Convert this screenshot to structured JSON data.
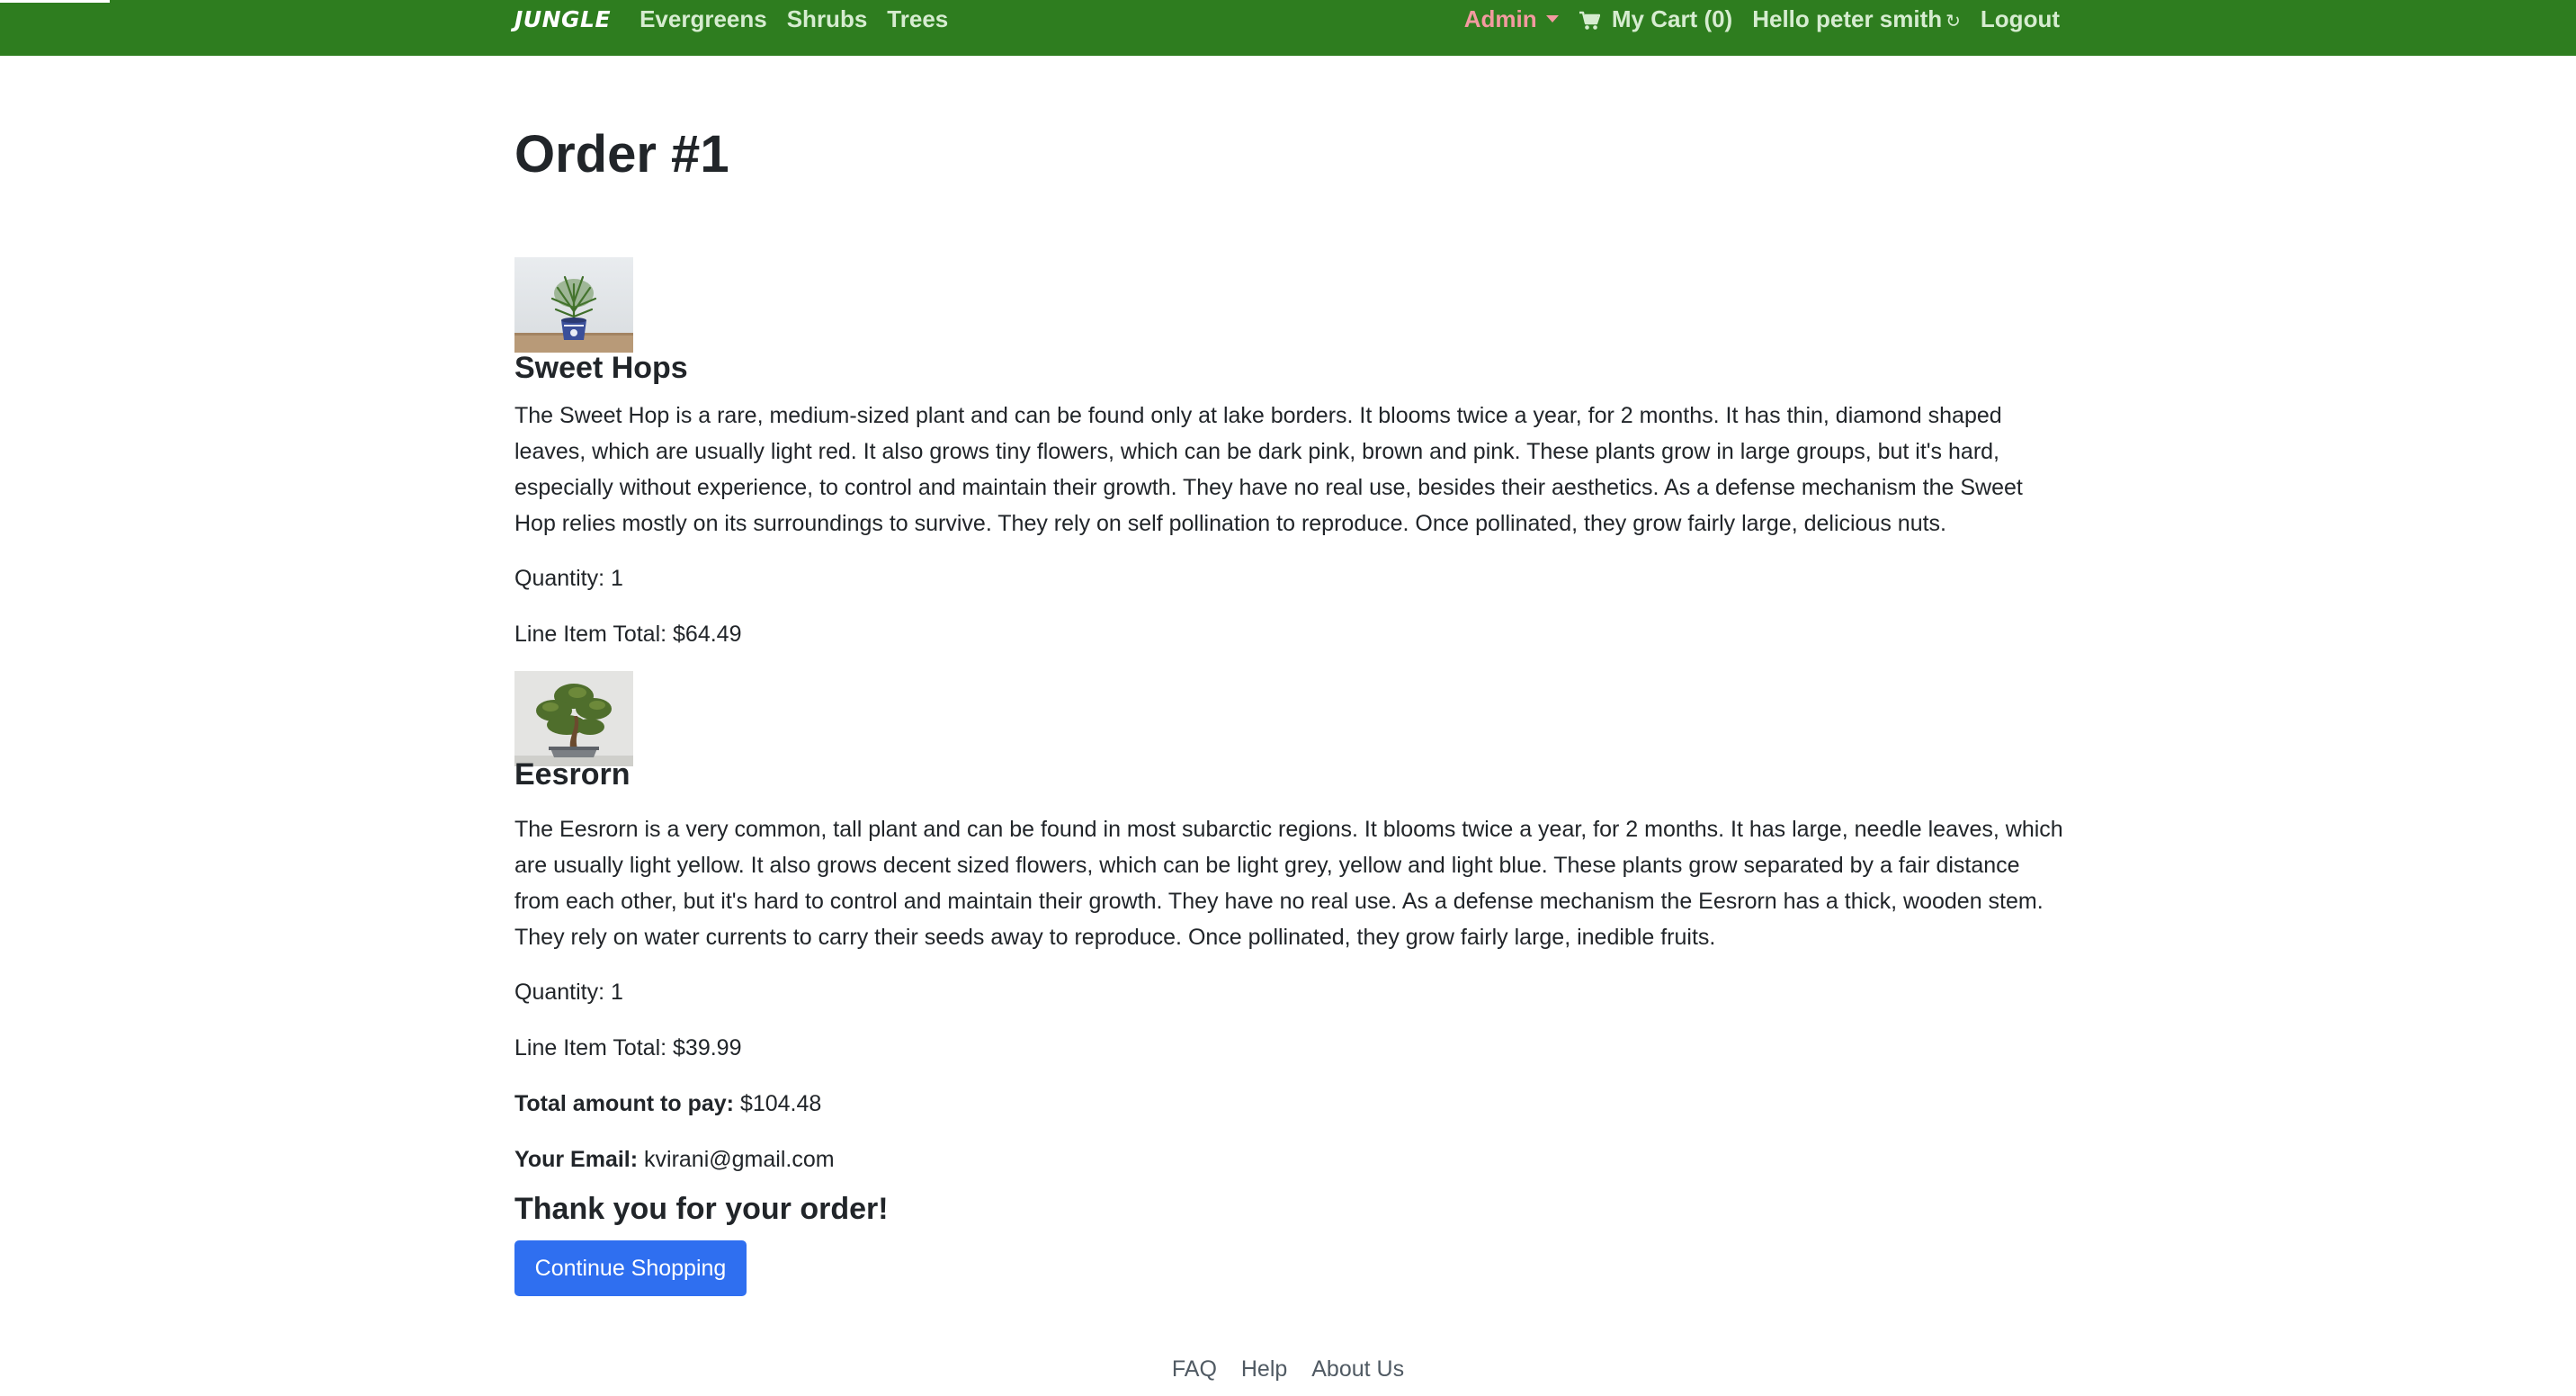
{
  "nav": {
    "brand": "JUNGLE",
    "links": [
      "Evergreens",
      "Shrubs",
      "Trees"
    ],
    "admin": "Admin",
    "cart": "My Cart (0)",
    "greeting": "Hello peter smith",
    "logout": "Logout",
    "colors": {
      "bar": "#2e7d1f",
      "admin": "#f39aa0"
    }
  },
  "order": {
    "title": "Order #1",
    "items": [
      {
        "name": "Sweet Hops",
        "description": "The Sweet Hop is a rare, medium-sized plant and can be found only at lake borders. It blooms twice a year, for 2 months. It has thin, diamond shaped leaves, which are usually light red. It also grows tiny flowers, which can be dark pink, brown and pink. These plants grow in large groups, but it's hard, especially without experience, to control and maintain their growth. They have no real use, besides their aesthetics. As a defense mechanism the Sweet Hop relies mostly on its surroundings to survive. They rely on self pollination to reproduce. Once pollinated, they grow fairly large, delicious nuts.",
        "quantity": "Quantity: 1",
        "line_total": "Line Item Total: $64.49",
        "image_icon": "potted-plant-icon"
      },
      {
        "name": "Eesrorn",
        "description": "The Eesrorn is a very common, tall plant and can be found in most subarctic regions. It blooms twice a year, for 2 months. It has large, needle leaves, which are usually light yellow. It also grows decent sized flowers, which can be light grey, yellow and light blue. These plants grow separated by a fair distance from each other, but it's hard to control and maintain their growth. They have no real use. As a defense mechanism the Eesrorn has a thick, wooden stem. They rely on water currents to carry their seeds away to reproduce. Once pollinated, they grow fairly large, inedible fruits.",
        "quantity": "Quantity: 1",
        "line_total": "Line Item Total: $39.99",
        "image_icon": "bonsai-tree-icon"
      }
    ],
    "total_label": "Total amount to pay:",
    "total_value": "$104.48",
    "email_label": "Your Email:",
    "email_value": "kvirani@gmail.com",
    "thanks": "Thank you for your order!",
    "continue_button": "Continue Shopping"
  },
  "footer": {
    "links": [
      "FAQ",
      "Help",
      "About Us"
    ]
  }
}
